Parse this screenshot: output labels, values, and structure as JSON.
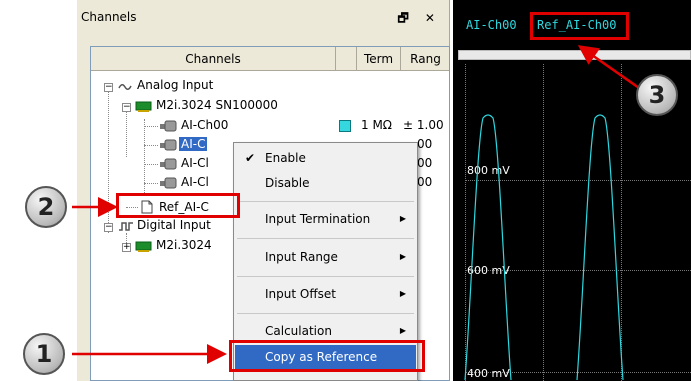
{
  "panel": {
    "title": "Channels",
    "buttons": "🗗 ✕"
  },
  "tree": {
    "columns": [
      "Channels",
      "Term",
      "Rang"
    ],
    "nodes": [
      {
        "label": "Analog Input"
      },
      {
        "label": "M2i.3024 SN100000"
      },
      {
        "label": "AI-Ch00",
        "term": "1 MΩ",
        "range": "± 1.00"
      },
      {
        "label": "AI-C",
        "term": "",
        "range": "00"
      },
      {
        "label": "AI-Cl",
        "term": "",
        "range": "00"
      },
      {
        "label": "AI-Cl",
        "term": "",
        "range": "00"
      },
      {
        "label": "Ref_AI-C"
      },
      {
        "label": "Digital Input"
      },
      {
        "label": "M2i.3024"
      }
    ]
  },
  "menu": {
    "items": [
      {
        "label": "Enable",
        "checked": true
      },
      {
        "label": "Disable"
      },
      {
        "label": "Input Termination",
        "submenu": true
      },
      {
        "label": "Input Range",
        "submenu": true
      },
      {
        "label": "Input Offset",
        "submenu": true
      },
      {
        "label": "Calculation",
        "submenu": true
      },
      {
        "label": "Copy as Reference",
        "highlighted": true
      }
    ]
  },
  "scope": {
    "tabs": [
      "AI-Ch00",
      "Ref_AI-Ch00"
    ],
    "ylabels": [
      "800 mV",
      "600 mV",
      "400 mV"
    ]
  },
  "callouts": [
    "1",
    "2",
    "3"
  ],
  "colors": {
    "accent": "#316ac5",
    "highlight_red": "#e00000",
    "trace": "#2ed8e0"
  }
}
